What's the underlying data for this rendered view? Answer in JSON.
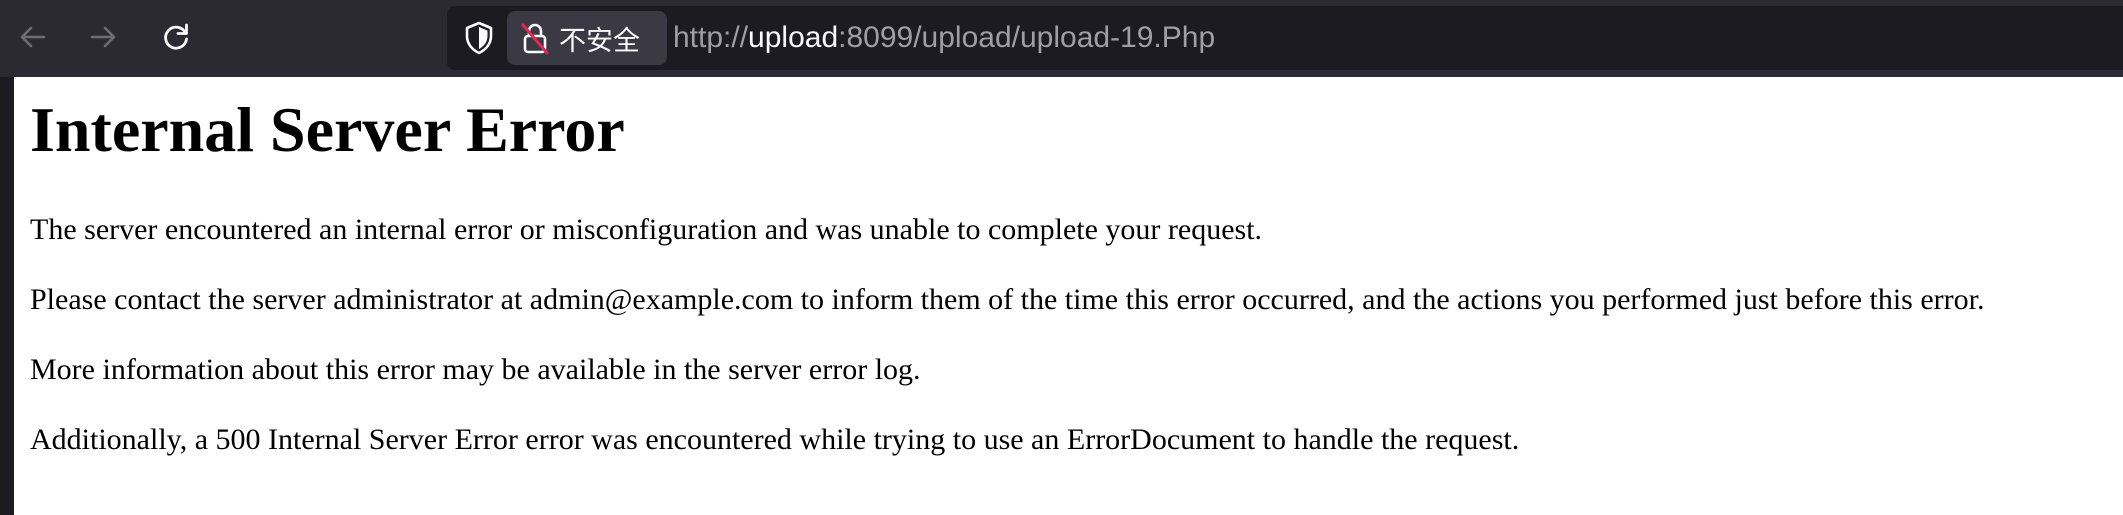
{
  "browser": {
    "nav": {
      "back_icon": "arrow-left-icon",
      "forward_icon": "arrow-right-icon",
      "reload_icon": "reload-icon"
    },
    "urlbar": {
      "shield_icon": "tracking-protection-shield-icon",
      "security_icon": "insecure-lock-icon",
      "security_label": "不安全",
      "url_scheme": "http://",
      "url_host": "upload",
      "url_rest": ":8099/upload/upload-19.Php"
    },
    "colors": {
      "toolbar_bg": "#2b2a33",
      "urlbar_bg": "#1c1b22",
      "chip_bg": "#3a3944",
      "insecure_strike": "#e22850"
    }
  },
  "page": {
    "title": "Internal Server Error",
    "paragraphs": [
      "The server encountered an internal error or misconfiguration and was unable to complete your request.",
      "Please contact the server administrator at admin@example.com to inform them of the time this error occurred, and the actions you performed just before this error.",
      "More information about this error may be available in the server error log.",
      "Additionally, a 500 Internal Server Error error was encountered while trying to use an ErrorDocument to handle the request."
    ]
  }
}
